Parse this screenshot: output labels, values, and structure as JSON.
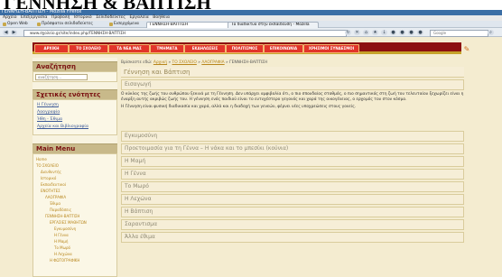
{
  "header_overlay": "ΓΕΝΝΗΣΗ & ΒΑΠΤΙΣΗ",
  "window": {
    "title": "ΓΕΝΝΗΣΗ-ΒΑΠΤΙΣΗ - Mozilla Firefox"
  },
  "menubar": {
    "items": [
      "Αρχείο",
      "Επεξεργασία",
      "Προβολή",
      "Ιστορικό",
      "Σελιδοδείκτες",
      "Εργαλεία",
      "Βοήθεια"
    ]
  },
  "bookmarks": {
    "items": [
      "Open Web",
      "Πρόσφατοι σελιδοδείκτες",
      "Εισερχόμενα"
    ]
  },
  "tabs": [
    {
      "label": "ΓΕΝΝΗΣΗ-ΒΑΠΤΙΣΗ",
      "active": true
    },
    {
      "label": "Το διαδίκτυο στην εκπαίδευση - Mozilla",
      "active": false
    }
  ],
  "address": {
    "url": "www.σχολείο.gr/site/index.php/ΓΕΝΝΗΣΗ-ΒΑΠΤΙΣΗ"
  },
  "search": {
    "placeholder": "Google"
  },
  "site_nav": {
    "items": [
      "ΑΡΧΙΚΗ",
      "ΤΟ ΣΧΟΛΕΙΟ",
      "ΤΑ ΝΕΑ ΜΑΣ",
      "ΤΜΗΜΑΤΑ",
      "ΕΚΔΗΛΩΣΕΙΣ",
      "ΠΟΛΙΤΙΣΜΟΣ",
      "ΕΠΙΚΟΙΝΩΝΙΑ",
      "ΧΡΗΣΙΜΟΙ ΣΥΝΔΕΣΜΟΙ"
    ]
  },
  "sidebar": {
    "search_title": "Αναζήτηση",
    "search_placeholder": "αναζήτηση...",
    "related_title": "Σχετικές ενότητες",
    "related_links": [
      "Η Γέννηση",
      "Λαογραφία",
      "Ήθη - Έθιμα",
      "Αρχεία και Βιβλιογραφία"
    ],
    "menu_title": "Main Menu",
    "menu_items": [
      "Home",
      "ΤΟ ΣΧΟΛΕΙΟ",
      "Διευθυντής",
      "Ιστορικό",
      "Εκπαιδευτικοί",
      "ΕΝΟΤΗΤΕΣ",
      "ΛΑΟΓΡΑΦΙΑ",
      "Έθιμα",
      "Παραδόσεις",
      "ΓΕΝΝΗΣΗ-ΒΑΠΤΙΣΗ",
      "ΕΡΓΑΣΙΕΣ ΜΑΘΗΤΩΝ",
      "Εγκυμοσύνη",
      "Η Γέννα",
      "Η Μαμή",
      "Το Μωρό",
      "Η Λεχώνα",
      "Η ΦΩΤΟΓΡΑΦΙΚΗ"
    ]
  },
  "main": {
    "breadcrumb": [
      "Βρίσκεστε εδώ:",
      "Αρχική",
      "ΤΟ ΣΧΟΛΕΙΟ",
      "ΛΑΟΓΡΑΦΙΑ",
      "ΓΕΝΝΗΣΗ-ΒΑΠΤΙΣΗ"
    ],
    "page_title": "Γέννηση και Βάπτιση",
    "intro_heading": "Εισαγωγή",
    "intro_paragraphs": [
      "Ο κύκλος της ζωής του ανθρώπου ξεκινά με τη Γέννηση. Δεν υπάρχει αμφιβολία ότι, ο πιο σπουδαίος σταθμός, ο πιο σημαντικός στη ζωή του τελευταίου ξεχωρίζει είναι η έναρξη αυτής ακριβώς ζωής του. Η γέννηση ενός παιδιού είναι το ευτυχέστερο γεγονός και χαρά της οικογένειας, ο ερχομός του στον κόσμο.",
      "Η Γέννηση είναι φυσική διαδικασία και χαρά, αλλά και η διαδοχή των γενεών, φέρνει νέες υποχρεώσεις στους γονείς."
    ],
    "sections": [
      "Εγκυμοσύνη",
      "Προετοιμασία για τη Γέννα – Η νάκα και το μπεσίκι (κούνια)",
      "Η Μαμή",
      "Η Γέννα",
      "Το Μωρό",
      "Η Λεχώνα",
      "Η Βάπτιση",
      "Σαραντισμα",
      "Άλλα έθιμα"
    ]
  }
}
